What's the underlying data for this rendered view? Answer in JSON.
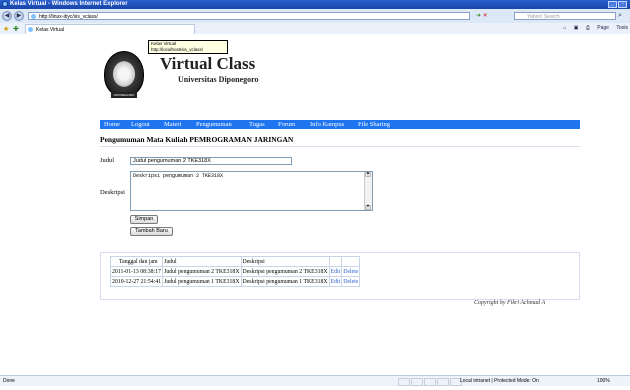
{
  "browser": {
    "window_title": "Kelas Virtual - Windows Internet Explorer",
    "url": "http://linux-ibyc/sis_vclass/",
    "search_placeholder": "Yahoo! Search",
    "tab_label": "Kelas Virtual",
    "toolbar": {
      "page": "Page",
      "tools": "Tools"
    },
    "status_left": "Done",
    "status_zone": "Local intranet | Protected Mode: On",
    "status_zoom": "100%"
  },
  "tooltip": {
    "line1": "Kelas Virtual",
    "line2": "http://localhost/sis_vclass/"
  },
  "site": {
    "title": "Virtual Class",
    "subtitle": "Universitas Diponegoro",
    "logo_text": "DIPONEGORO"
  },
  "menu": [
    "Home",
    "Logout",
    "Materi",
    "Pengumuman",
    "Tugas",
    "Forum",
    "Info Kampus",
    "File Sharing"
  ],
  "page": {
    "title": "Pengumuman Mata Kuliah PEMROGRAMAN JARINGAN"
  },
  "form": {
    "judul_label": "Judul",
    "judul_value": "Judul pengumuman 2 TKE318X",
    "deskripsi_label": "Deskripsi",
    "deskripsi_value": "Deskripsi pengumuman 2 TKE318X",
    "save_label": "Simpan",
    "new_label": "Tambah Baru"
  },
  "table": {
    "headers": [
      "Tanggal dan jam",
      "Judul",
      "Deskripsi"
    ],
    "rows": [
      {
        "datetime": "2011-01-13 08:38:17",
        "judul": "Judul pengumuman 2 TKE318X",
        "deskripsi": "Deskripsi pengumuman 2 TKE318X",
        "edit": "Edit",
        "delete": "Delete"
      },
      {
        "datetime": "2010-12-27 21:54:41",
        "judul": "Judul pengumuman 1 TKE318X",
        "deskripsi": "Deskripsi pengumuman 1 TKE318X",
        "edit": "Edit",
        "delete": "Delete"
      }
    ]
  },
  "footer": {
    "copyright": "Copyright by Fikri Achmad A"
  }
}
